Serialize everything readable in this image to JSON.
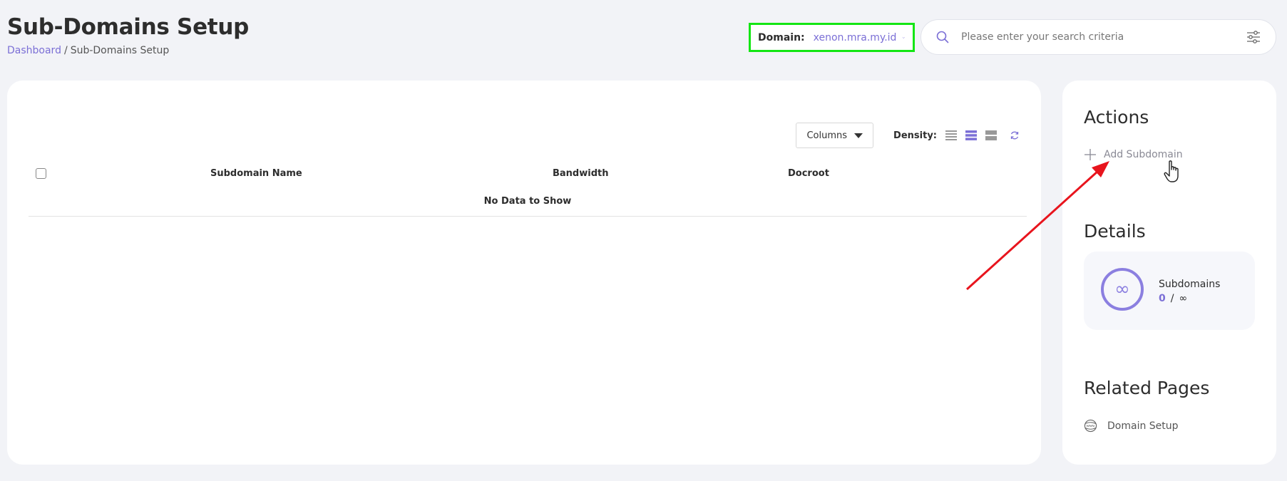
{
  "header": {
    "title": "Sub-Domains Setup",
    "breadcrumb": {
      "home": "Dashboard",
      "separator": "/",
      "current": "Sub-Domains Setup"
    }
  },
  "domain_selector": {
    "label": "Domain:",
    "value": "xenon.mra.my.id",
    "highlight_color": "#14e614"
  },
  "search": {
    "placeholder": "Please enter your search criteria"
  },
  "table": {
    "toolbar": {
      "columns_label": "Columns",
      "density_label": "Density:",
      "density_selected": "standard"
    },
    "columns": [
      "Subdomain Name",
      "Bandwidth",
      "Docroot"
    ],
    "empty_message": "No Data to Show"
  },
  "sidebar": {
    "actions_heading": "Actions",
    "add_subdomain_label": "Add Subdomain",
    "details_heading": "Details",
    "details": {
      "label": "Subdomains",
      "used": "0",
      "separator": "/",
      "limit": "∞",
      "icon": "∞"
    },
    "related_heading": "Related Pages",
    "related_link": "Domain Setup"
  },
  "colors": {
    "accent": "#7b6fd6",
    "annotation_arrow": "#e8141d"
  }
}
